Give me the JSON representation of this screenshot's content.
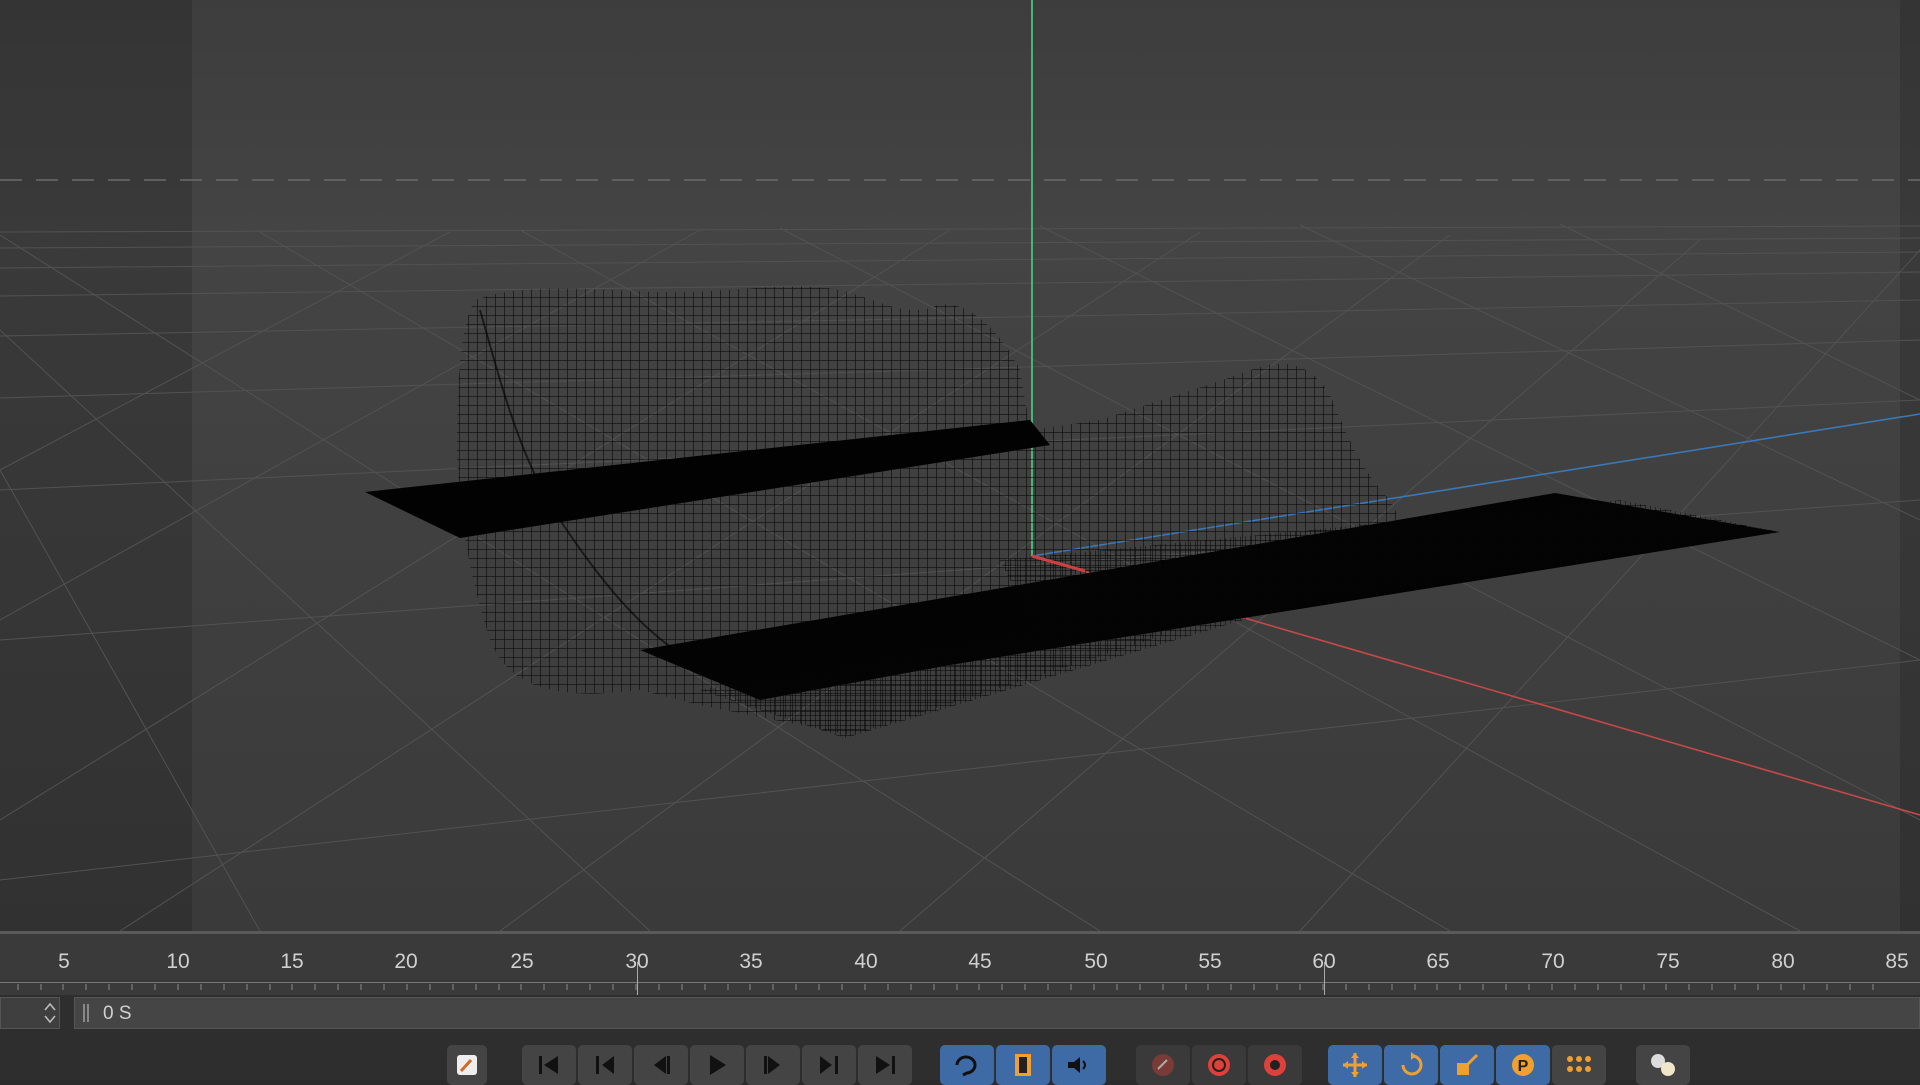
{
  "timeline": {
    "ticks": [
      "5",
      "10",
      "15",
      "20",
      "25",
      "30",
      "35",
      "40",
      "45",
      "50",
      "55",
      "60",
      "65",
      "70",
      "75",
      "80",
      "85"
    ],
    "current_time": "0 S"
  },
  "toolbar": {
    "edit_icon": "bone-brush-icon",
    "playback_icons": [
      "go-to-start-icon",
      "previous-key-icon",
      "previous-frame-icon",
      "play-icon",
      "next-frame-icon",
      "next-key-icon",
      "go-to-end-icon"
    ],
    "mode_icons": [
      "loop-icon",
      "film-icon",
      "sound-icon"
    ],
    "record_icons": [
      "record-key-icon",
      "autokey-icon",
      "keyframe-settings-icon"
    ],
    "transform_icons": [
      "move-icon",
      "rotate-icon",
      "scale-icon",
      "parameter-icon",
      "points-icon"
    ],
    "extra_icons": [
      "interpolation-icon"
    ]
  },
  "colors": {
    "accent": "#3e6aa6",
    "orange": "#f0a030",
    "record_red": "#e0403a",
    "axis_x": "#c84848",
    "axis_y": "#3fb87a",
    "axis_z": "#3a78b8"
  }
}
